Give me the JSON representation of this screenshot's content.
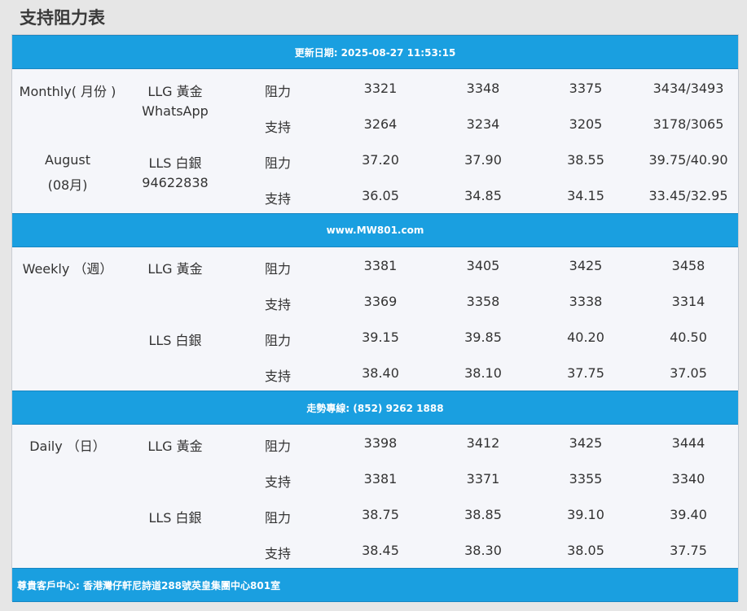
{
  "title": "支持阻力表",
  "bands": {
    "update": "更新日期: 2025-08-27 11:53:15",
    "website": "www.MW801.com",
    "hotline": "走勢專線: (852) 9262 1888",
    "address": "尊貴客戶中心: 香港灣仔軒尼詩道288號英皇集團中心801室"
  },
  "sections": {
    "monthly": {
      "period_1": "Monthly( 月份 )",
      "period_2": "August",
      "period_3": "(08月)",
      "gold_label": "LLG 黃金",
      "gold_sub": "WhatsApp",
      "silver_label": "LLS 白銀",
      "silver_sub": "94622838",
      "gold_resistance": [
        "阻力",
        "3321",
        "3348",
        "3375",
        "3434/3493"
      ],
      "gold_support": [
        "支持",
        "3264",
        "3234",
        "3205",
        "3178/3065"
      ],
      "silver_resistance": [
        "阻力",
        "37.20",
        "37.90",
        "38.55",
        "39.75/40.90"
      ],
      "silver_support": [
        "支持",
        "36.05",
        "34.85",
        "34.15",
        "33.45/32.95"
      ]
    },
    "weekly": {
      "period_1": "Weekly （週）",
      "gold_label": "LLG 黃金",
      "silver_label": "LLS 白銀",
      "gold_resistance": [
        "阻力",
        "3381",
        "3405",
        "3425",
        "3458"
      ],
      "gold_support": [
        "支持",
        "3369",
        "3358",
        "3338",
        "3314"
      ],
      "silver_resistance": [
        "阻力",
        "39.15",
        "39.85",
        "40.20",
        "40.50"
      ],
      "silver_support": [
        "支持",
        "38.40",
        "38.10",
        "37.75",
        "37.05"
      ]
    },
    "daily": {
      "period_1": "Daily （日）",
      "gold_label": "LLG 黃金",
      "silver_label": "LLS 白銀",
      "gold_resistance": [
        "阻力",
        "3398",
        "3412",
        "3425",
        "3444"
      ],
      "gold_support": [
        "支持",
        "3381",
        "3371",
        "3355",
        "3340"
      ],
      "silver_resistance": [
        "阻力",
        "38.75",
        "38.85",
        "39.10",
        "39.40"
      ],
      "silver_support": [
        "支持",
        "38.45",
        "38.30",
        "38.05",
        "37.75"
      ]
    }
  },
  "colors": {
    "band": "#1a9fe0",
    "table_bg": "#f5f6fa",
    "page_bg": "#e6e6e6"
  }
}
